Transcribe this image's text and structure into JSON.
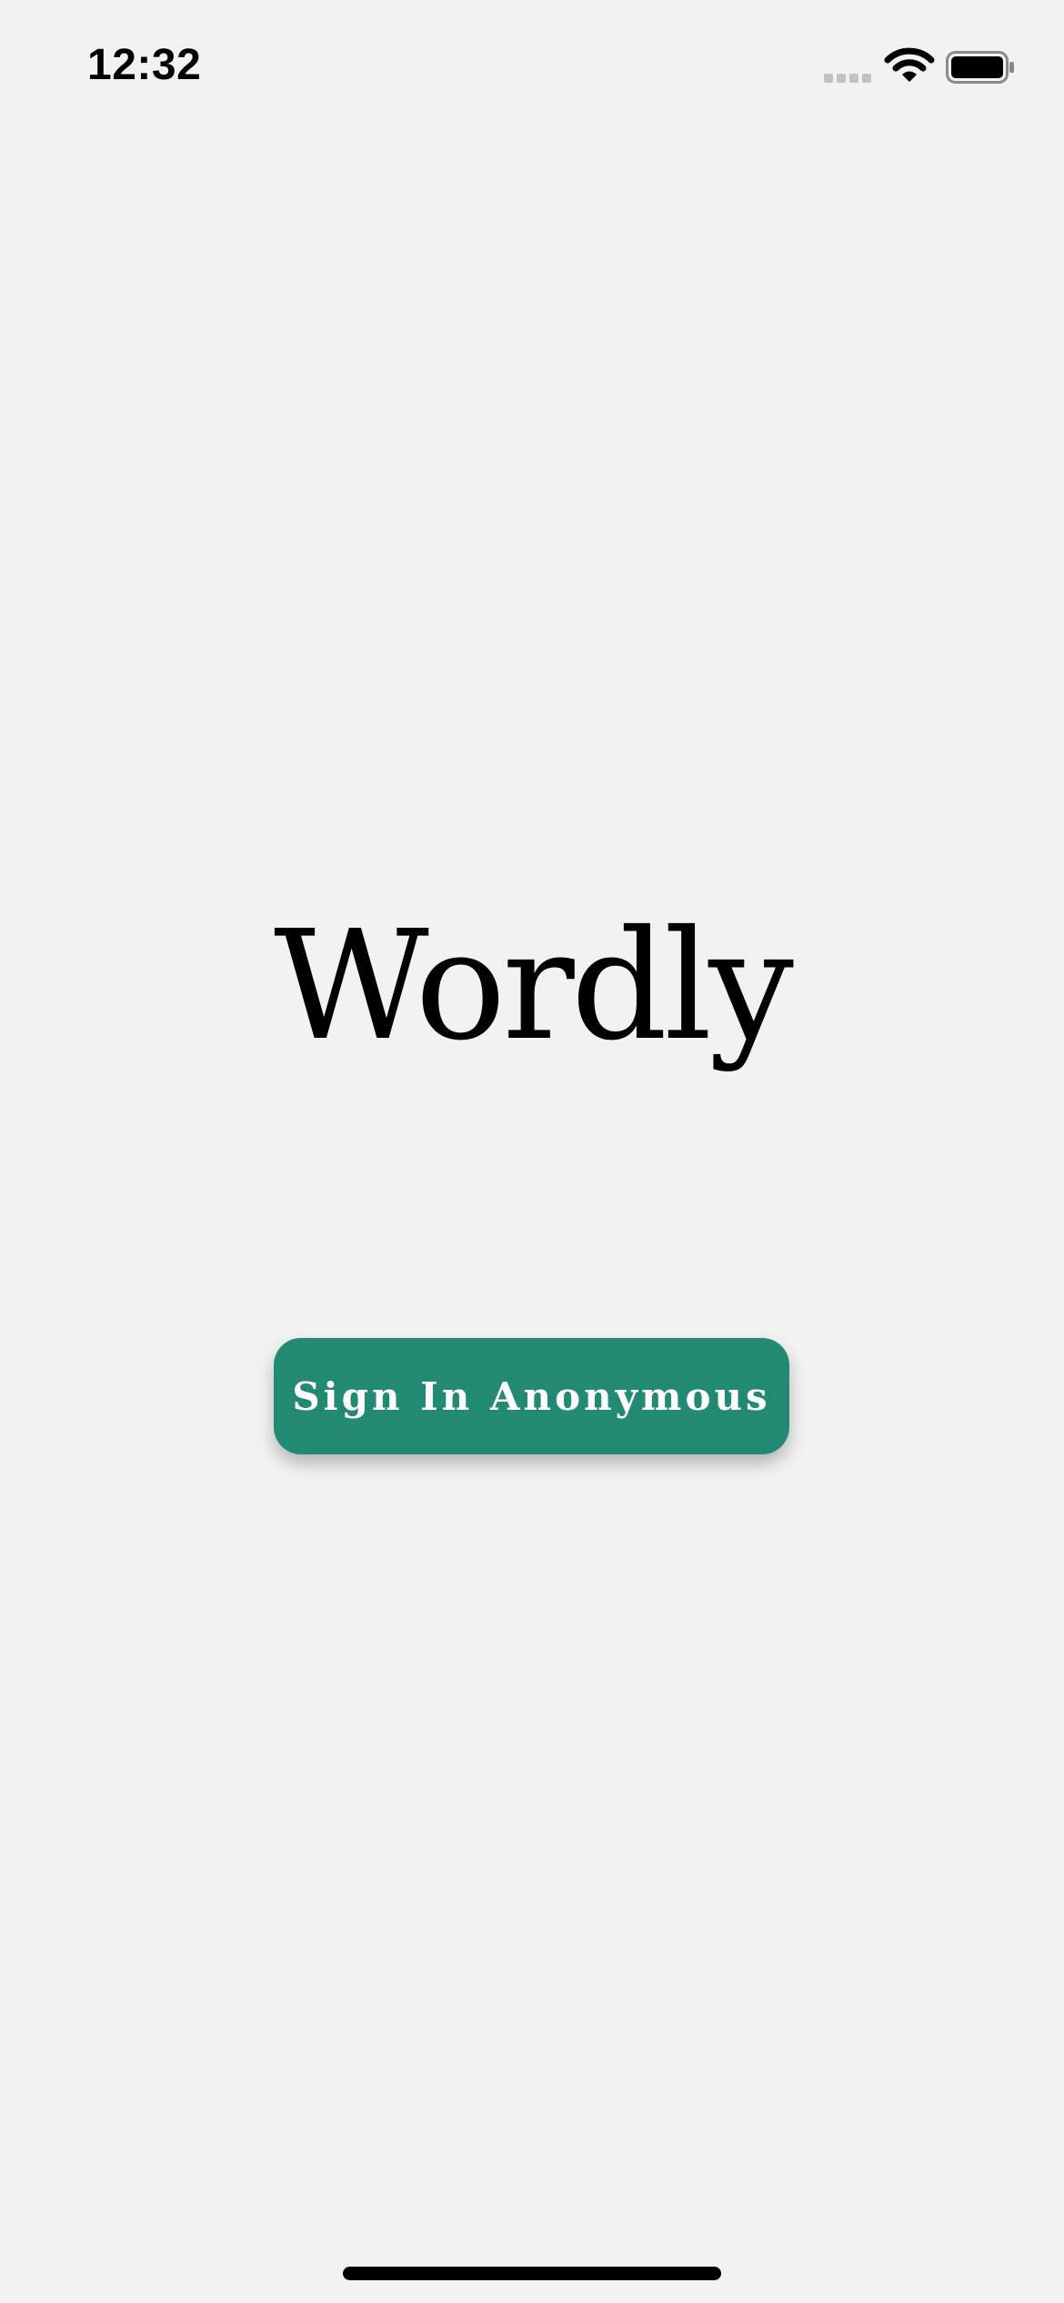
{
  "status_bar": {
    "time": "12:32",
    "icons": [
      "cellular-signal-icon",
      "wifi-icon",
      "battery-icon"
    ]
  },
  "app": {
    "title": "Wordly"
  },
  "actions": {
    "signin_label": "Sign In Anonymous"
  },
  "colors": {
    "background": "#f2f2f2",
    "button": "#228a73",
    "button_text": "#ffffff",
    "title_text": "#000000"
  }
}
